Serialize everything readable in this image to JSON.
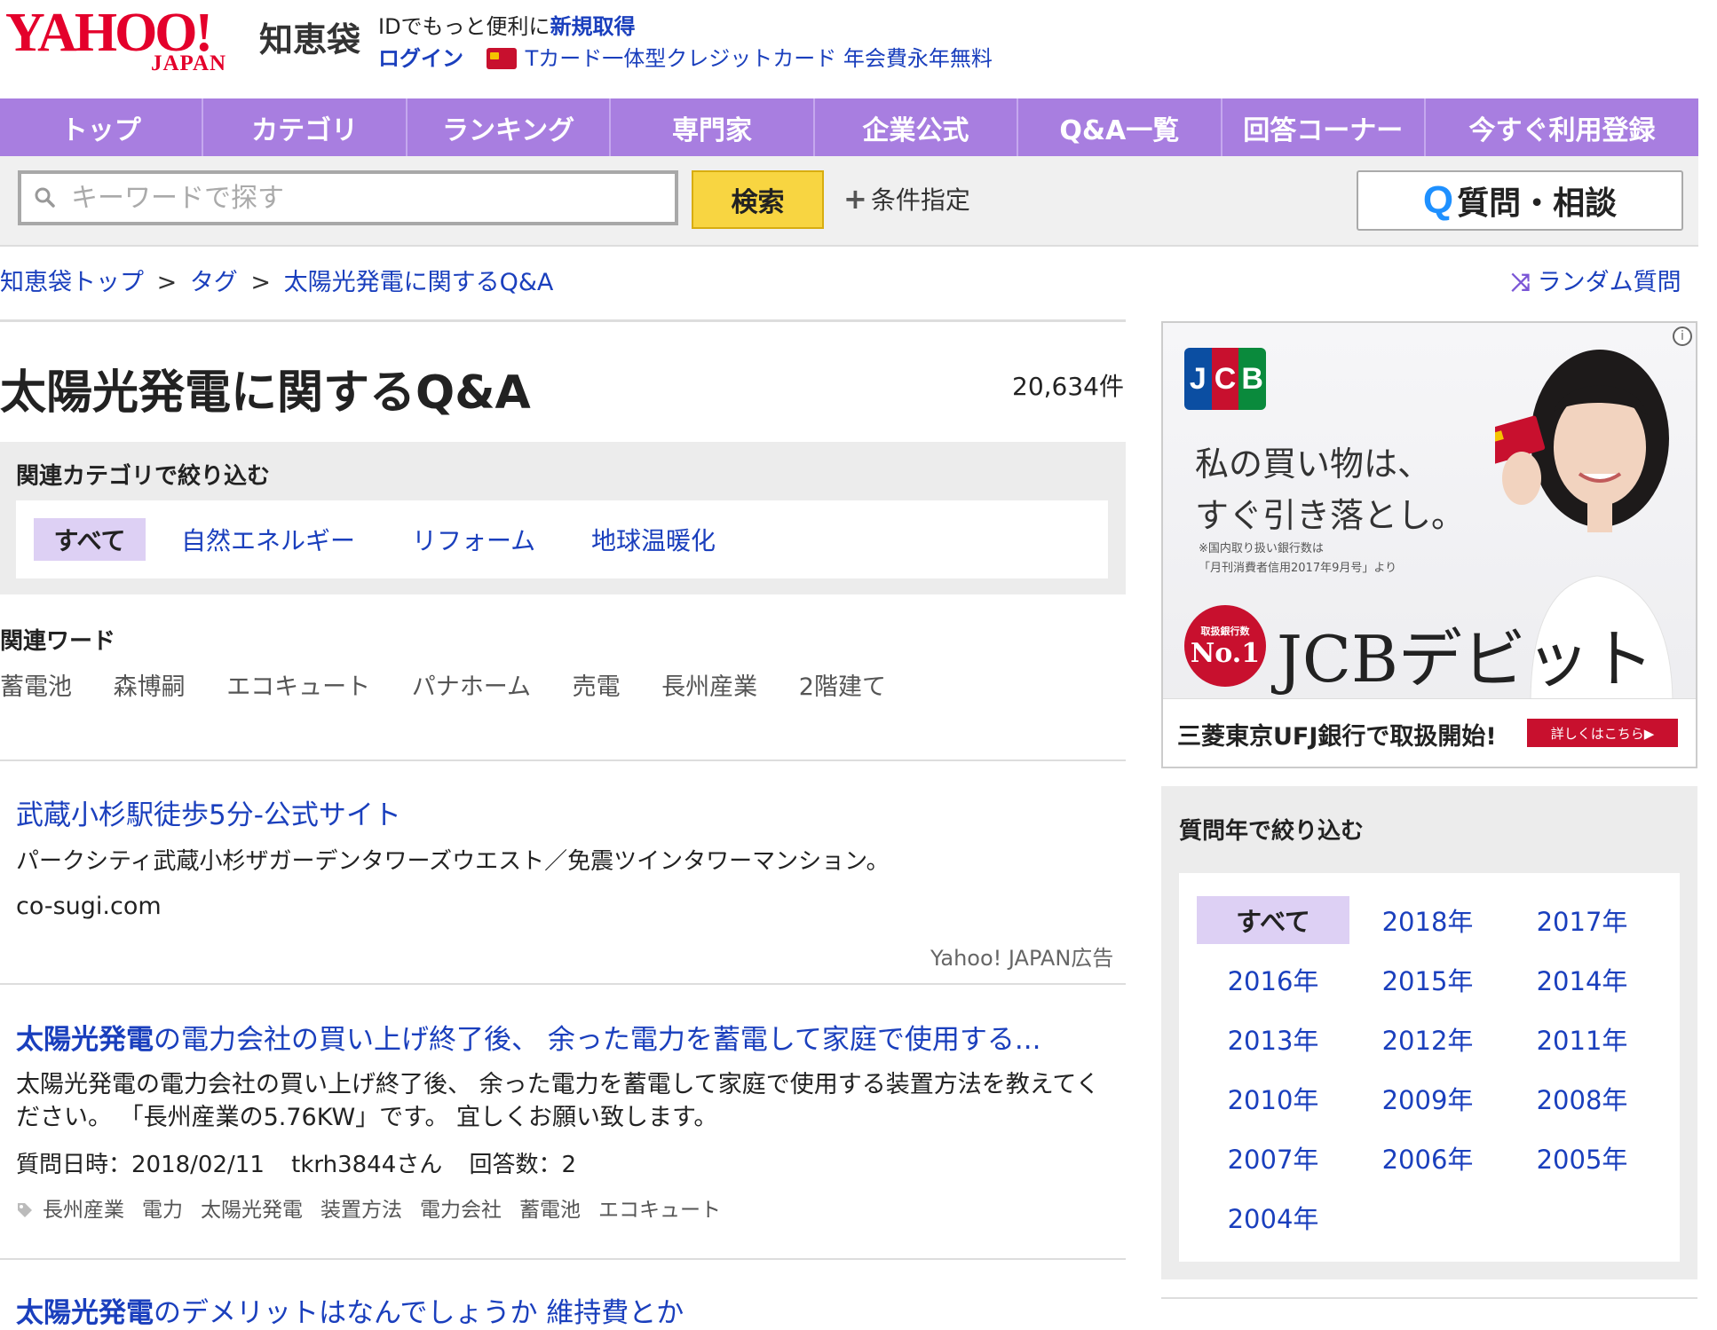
{
  "header": {
    "logo_main": "YAHOO!",
    "logo_sub": "JAPAN",
    "service": "知恵袋",
    "id_text": "IDでもっと便利に",
    "signup": "新規取得",
    "login": "ログイン",
    "promo": "Tカード一体型クレジットカード 年会費永年無料"
  },
  "nav": [
    "トップ",
    "カテゴリ",
    "ランキング",
    "専門家",
    "企業公式",
    "Q&A一覧",
    "回答コーナー",
    "今すぐ利用登録"
  ],
  "search": {
    "placeholder": "キーワードで探す",
    "button": "検索",
    "conditions": "条件指定",
    "ask_q": "Q",
    "ask": "質問・相談"
  },
  "breadcrumb": {
    "items": [
      "知恵袋トップ",
      "タグ",
      "太陽光発電に関するQ&A"
    ],
    "sep": ">",
    "random": "ランダム質問"
  },
  "page": {
    "title": "太陽光発電に関するQ&A",
    "count": "20,634件"
  },
  "category_filter": {
    "title": "関連カテゴリで絞り込む",
    "items": [
      "すべて",
      "自然エネルギー",
      "リフォーム",
      "地球温暖化"
    ]
  },
  "related": {
    "title": "関連ワード",
    "words": [
      "蓄電池",
      "森博嗣",
      "エコキュート",
      "パナホーム",
      "売電",
      "長州産業",
      "2階建て"
    ]
  },
  "sponsored": {
    "title": "武蔵小杉駅徒歩5分-公式サイト",
    "desc": "パークシティ武蔵小杉ザガーデンタワーズウエスト／免震ツインタワーマンション。",
    "domain": "co-sugi.com",
    "label": "Yahoo! JAPAN広告"
  },
  "questions": [
    {
      "title_bold": "太陽光発電",
      "title_rest": "の電力会社の買い上げ終了後、 余った電力を蓄電して家庭で使用する...",
      "body": "太陽光発電の電力会社の買い上げ終了後、 余った電力を蓄電して家庭で使用する装置方法を教えてください。 「長州産業の5.76KW」です。 宜しくお願い致します。",
      "date": "質問日時：2018/02/11",
      "user": "tkrh3844さん",
      "answers": "回答数：2",
      "tags": [
        "長州産業",
        "電力",
        "太陽光発電",
        "装置方法",
        "電力会社",
        "蓄電池",
        "エコキュート"
      ]
    },
    {
      "title_bold": "太陽光発電",
      "title_rest": "のデメリットはなんでしょうか 維持費とか"
    }
  ],
  "ad_banner": {
    "logo": [
      "J",
      "C",
      "B"
    ],
    "copy_line1": "私の買い物は、",
    "copy_line2": "すぐ引き落とし。",
    "note_line1": "※国内取り扱い銀行数は",
    "note_line2": "「月刊消費者信用2017年9月号」より",
    "badge_small": "取扱銀行数",
    "badge_big": "No.1",
    "product": "JCBデビット",
    "footer": "三菱東京UFJ銀行で取扱開始!",
    "footer_btn": "詳しくはこちら▶"
  },
  "year_filter": {
    "title": "質問年で絞り込む",
    "items": [
      "すべて",
      "2018年",
      "2017年",
      "2016年",
      "2015年",
      "2014年",
      "2013年",
      "2012年",
      "2011年",
      "2010年",
      "2009年",
      "2008年",
      "2007年",
      "2006年",
      "2005年",
      "2004年"
    ]
  },
  "colors": {
    "nav": "#a87ee0",
    "link": "#1a3fbd",
    "search_button": "#f8d541",
    "active_chip": "#ddd0f4",
    "brand_red": "#e4002b"
  }
}
